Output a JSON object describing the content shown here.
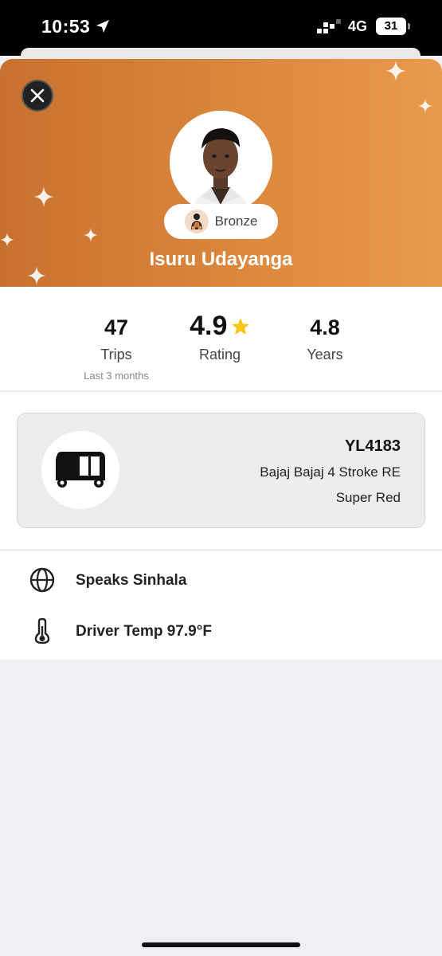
{
  "status_bar": {
    "time": "10:53",
    "network": "4G",
    "battery": "31"
  },
  "header": {
    "close_icon": "close-icon",
    "tier_label": "Bronze",
    "driver_name": "Isuru Udayanga",
    "gradient_colors": [
      "#c8712f",
      "#e99a4b"
    ]
  },
  "stats": {
    "trips": {
      "value": "47",
      "label": "Trips",
      "sub": "Last 3 months"
    },
    "rating": {
      "value": "4.9",
      "label": "Rating",
      "star_color": "#f5c518"
    },
    "years": {
      "value": "4.8",
      "label": "Years"
    }
  },
  "vehicle": {
    "icon": "tuk-tuk-icon",
    "plate": "YL4183",
    "model": "Bajaj Bajaj 4 Stroke RE",
    "color": "Super Red"
  },
  "info": [
    {
      "icon": "globe-icon",
      "text": "Speaks Sinhala"
    },
    {
      "icon": "thermometer-icon",
      "text": "Driver Temp 97.9°F"
    }
  ]
}
